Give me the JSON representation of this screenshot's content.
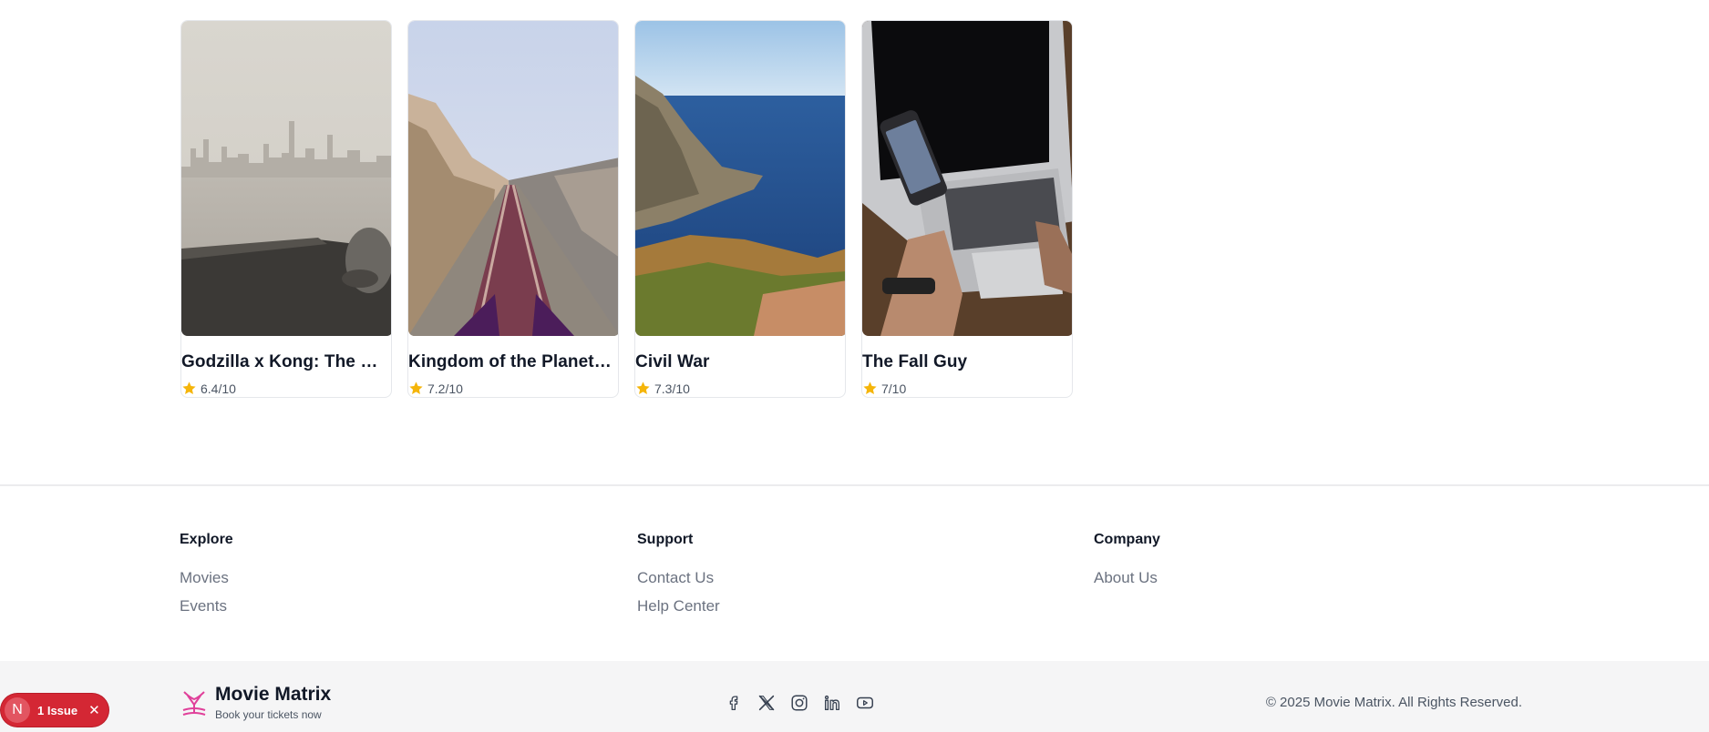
{
  "movies": [
    {
      "title": "Godzilla x Kong: The New Empire",
      "rating": "6.4/10",
      "poster": "city-shore-image"
    },
    {
      "title": "Kingdom of the Planet of the Apes",
      "rating": "7.2/10",
      "poster": "railway-coast-image"
    },
    {
      "title": "Civil War",
      "rating": "7.3/10",
      "poster": "sea-cliff-image"
    },
    {
      "title": "The Fall Guy",
      "rating": "7/10",
      "poster": "phone-laptop-image"
    }
  ],
  "footer": {
    "explore": {
      "heading": "Explore",
      "links": [
        "Movies",
        "Events"
      ]
    },
    "support": {
      "heading": "Support",
      "links": [
        "Contact Us",
        "Help Center"
      ]
    },
    "company": {
      "heading": "Company",
      "links": [
        "About Us"
      ]
    }
  },
  "brand": {
    "name": "Movie Matrix",
    "tagline": "Book your tickets now",
    "accent": "#e0409a"
  },
  "socials": [
    "facebook-icon",
    "x-icon",
    "instagram-icon",
    "linkedin-icon",
    "youtube-icon"
  ],
  "copyright": "© 2025 Movie Matrix. All Rights Reserved.",
  "issue_badge": {
    "letter": "N",
    "label": "1 Issue",
    "color": "#d42734"
  },
  "colors": {
    "star": "#f5b50a",
    "link": "#6b7280"
  }
}
